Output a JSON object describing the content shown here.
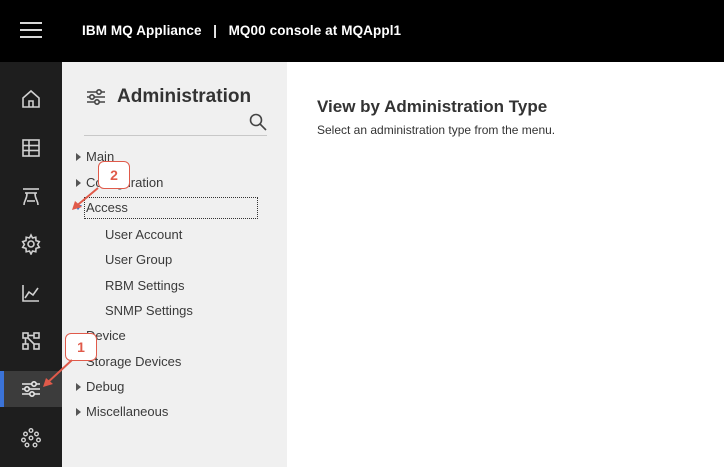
{
  "header": {
    "title": "IBM MQ Appliance   |   MQ00 console at MQAppl1"
  },
  "rail": {
    "items": [
      {
        "icon": "home-icon"
      },
      {
        "icon": "table-icon"
      },
      {
        "icon": "queue-manager-icon"
      },
      {
        "icon": "gear-icon"
      },
      {
        "icon": "chart-icon"
      },
      {
        "icon": "network-icon"
      },
      {
        "icon": "sliders-icon",
        "active": true
      },
      {
        "icon": "apps-grid-icon"
      }
    ]
  },
  "nav": {
    "title": "Administration",
    "items": [
      {
        "label": "Main"
      },
      {
        "label": "Configuration"
      },
      {
        "label": "Access"
      },
      {
        "label": "User Account"
      },
      {
        "label": "User Group"
      },
      {
        "label": "RBM Settings"
      },
      {
        "label": "SNMP Settings"
      },
      {
        "label": "Device"
      },
      {
        "label": "Storage Devices"
      },
      {
        "label": "Debug"
      },
      {
        "label": "Miscellaneous"
      }
    ]
  },
  "main": {
    "title": "View by Administration Type",
    "description": "Select an administration type from the menu."
  },
  "callouts": [
    {
      "number": "1"
    },
    {
      "number": "2"
    }
  ],
  "colors": {
    "topbar": "#000000",
    "rail": "#1e1e1e",
    "rail_active_indicator": "#3b73d8",
    "nav_panel": "#f0f0f0",
    "caret_expanded": "#2f7bd6",
    "callout": "#e05a4a"
  }
}
